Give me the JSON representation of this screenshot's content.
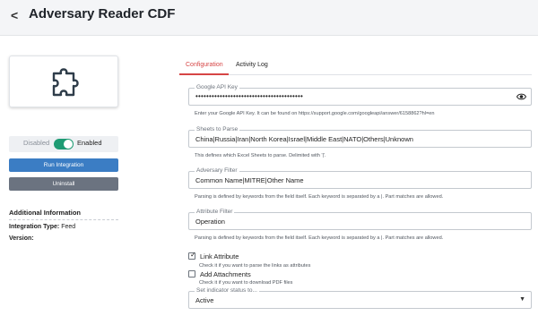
{
  "header": {
    "back_icon": "chevron-left-icon",
    "title": "Adversary Reader CDF"
  },
  "sidebar": {
    "plugin_icon": "puzzle-piece-icon",
    "toggle": {
      "off_label": "Disabled",
      "on_label": "Enabled",
      "state": "on",
      "color": "#1e9b73"
    },
    "run_button": "Run Integration",
    "uninstall_button": "Uninstall",
    "info": {
      "title": "Additional Information",
      "type_label": "Integration Type:",
      "type_value": "Feed",
      "version_label": "Version:"
    }
  },
  "tabs": [
    {
      "label": "Configuration",
      "active": true
    },
    {
      "label": "Activity Log",
      "active": false
    }
  ],
  "accent_color": "#d64545",
  "fields": {
    "api_key": {
      "label": "Google API Key",
      "value": "••••••••••••••••••••••••••••••••••••••••",
      "help": "Enter your Google API Key. It can be found on https://support.google.com/googleapi/answer/6158862?hl=en",
      "eye_icon": "eye-icon"
    },
    "sheets": {
      "label": "Sheets to Parse",
      "value": "China|Russia|Iran|North Korea|Israel|Middle East|NATO|Others|Unknown",
      "help": "This defines which Excel Sheets to parse. Delimited with '|'."
    },
    "adversary_filter": {
      "label": "Adversary Filter",
      "value": "Common Name|MITRE|Other Name",
      "help": "Parsing is defined by keywords from the field itself. Each keyword is separated by a |. Part matches are allowed."
    },
    "attribute_filter": {
      "label": "Attribute Filter",
      "value": "Operation",
      "help": "Parsing is defined by keywords from the field itself. Each keyword is separated by a |. Part matches are allowed."
    },
    "link_attribute": {
      "label": "Link Attribute",
      "checked": true,
      "help": "Check it if you want to parse the links as attributes"
    },
    "add_attachments": {
      "label": "Add Attachments",
      "checked": false,
      "help": "Check it if you want to download PDF files"
    },
    "indicator_status": {
      "label": "Set indicator status to...",
      "value": "Active",
      "chevron_icon": "chevron-down-icon"
    }
  }
}
